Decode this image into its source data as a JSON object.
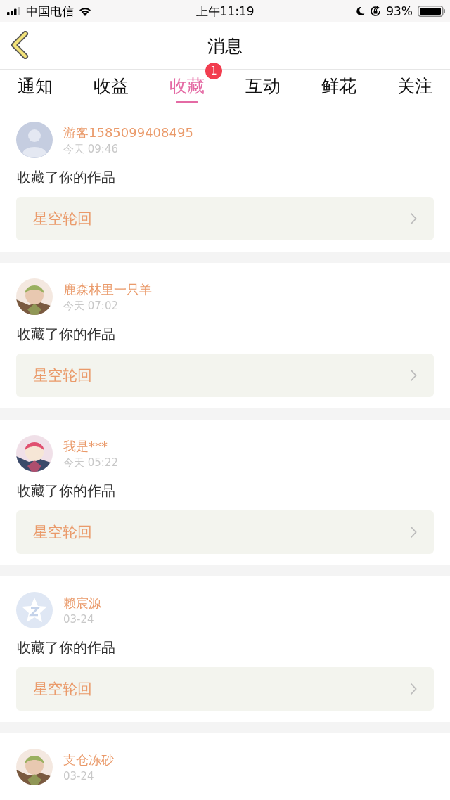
{
  "status_bar": {
    "carrier": "中国电信",
    "time": "上午11:19",
    "battery": "93%"
  },
  "nav": {
    "title": "消息"
  },
  "tabs": [
    {
      "label": "通知",
      "selected": false
    },
    {
      "label": "收益",
      "selected": false
    },
    {
      "label": "收藏",
      "selected": true,
      "badge": "1"
    },
    {
      "label": "互动",
      "selected": false
    },
    {
      "label": "鲜花",
      "selected": false
    },
    {
      "label": "关注",
      "selected": false
    }
  ],
  "messages": [
    {
      "avatar": {
        "kind": "default"
      },
      "name": "游客1585099408495",
      "time": "今天 09:46",
      "text": "收藏了你的作品",
      "work": "星空轮回"
    },
    {
      "name": "鹿森林里一只羊",
      "time": "今天 07:02",
      "text": "收藏了你的作品",
      "work": "星空轮回"
    },
    {
      "name": "我是***",
      "time": "今天 05:22",
      "text": "收藏了你的作品",
      "work": "星空轮回"
    },
    {
      "avatar": {
        "kind": "star"
      },
      "name": "赖宸源",
      "time": "03-24",
      "text": "收藏了你的作品",
      "work": "星空轮回"
    },
    {
      "name": "支仓冻砂",
      "time": "03-24"
    }
  ]
}
